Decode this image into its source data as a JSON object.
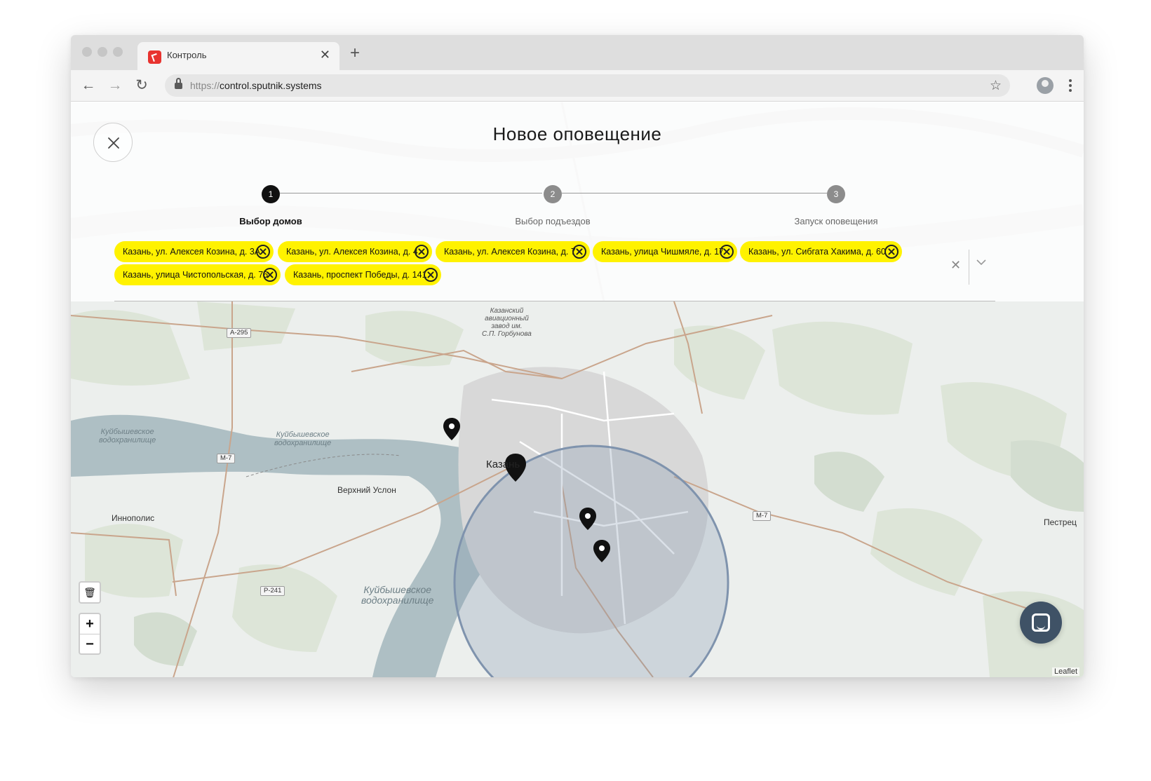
{
  "browser": {
    "tab_title": "Контроль",
    "tab_close": "✕",
    "new_tab": "+",
    "url_protocol": "https://",
    "url_host": "control.sputnik.systems",
    "back_icon": "←",
    "forward_icon": "→",
    "reload_icon": "↻",
    "star_icon": "☆"
  },
  "page": {
    "title": "Новое оповещение"
  },
  "stepper": {
    "steps": [
      {
        "number": "1",
        "label": "Выбор домов",
        "active": true
      },
      {
        "number": "2",
        "label": "Выбор подъездов",
        "active": false
      },
      {
        "number": "3",
        "label": "Запуск оповещения",
        "active": false
      }
    ],
    "colors": {
      "active": "#111111",
      "inactive": "#8c8c8c"
    }
  },
  "selection": {
    "chip_color": "#fff200",
    "chips": [
      "Казань, ул. Алексея Козина, д. 3А",
      "Казань, ул. Алексея Козина, д. 4",
      "Казань, ул. Алексея Козина, д. 7",
      "Казань, улица Чишмяле, д. 17",
      "Казань, ул. Сибгата Хакима, д. 60",
      "Казань, улица Чистопольская, д. 76",
      "Казань, проспект Победы, д. 141"
    ],
    "clear_icon": "✕"
  },
  "map": {
    "labels": {
      "kazan": "Казань",
      "verkhniy_uslon": "Верхний Услон",
      "innopolis": "Иннополис",
      "pestrecy": "Пестрец",
      "plant": "Казанский\nавиационный\nзавод им.\nС.П. Горбунова",
      "reservoir_1": "Куйбышевское\nводохранилище",
      "reservoir_2": "Куйбышевское\nводохранилище",
      "reservoir_3": "Куйбышевское\nводохранилище"
    },
    "roads": [
      "А-295",
      "М-7",
      "М-7",
      "Р-241"
    ],
    "controls": {
      "delete_icon": "🗑",
      "zoom_in": "+",
      "zoom_out": "−"
    },
    "attribution": "Leaflet",
    "circle_color": "#7f93ad"
  }
}
